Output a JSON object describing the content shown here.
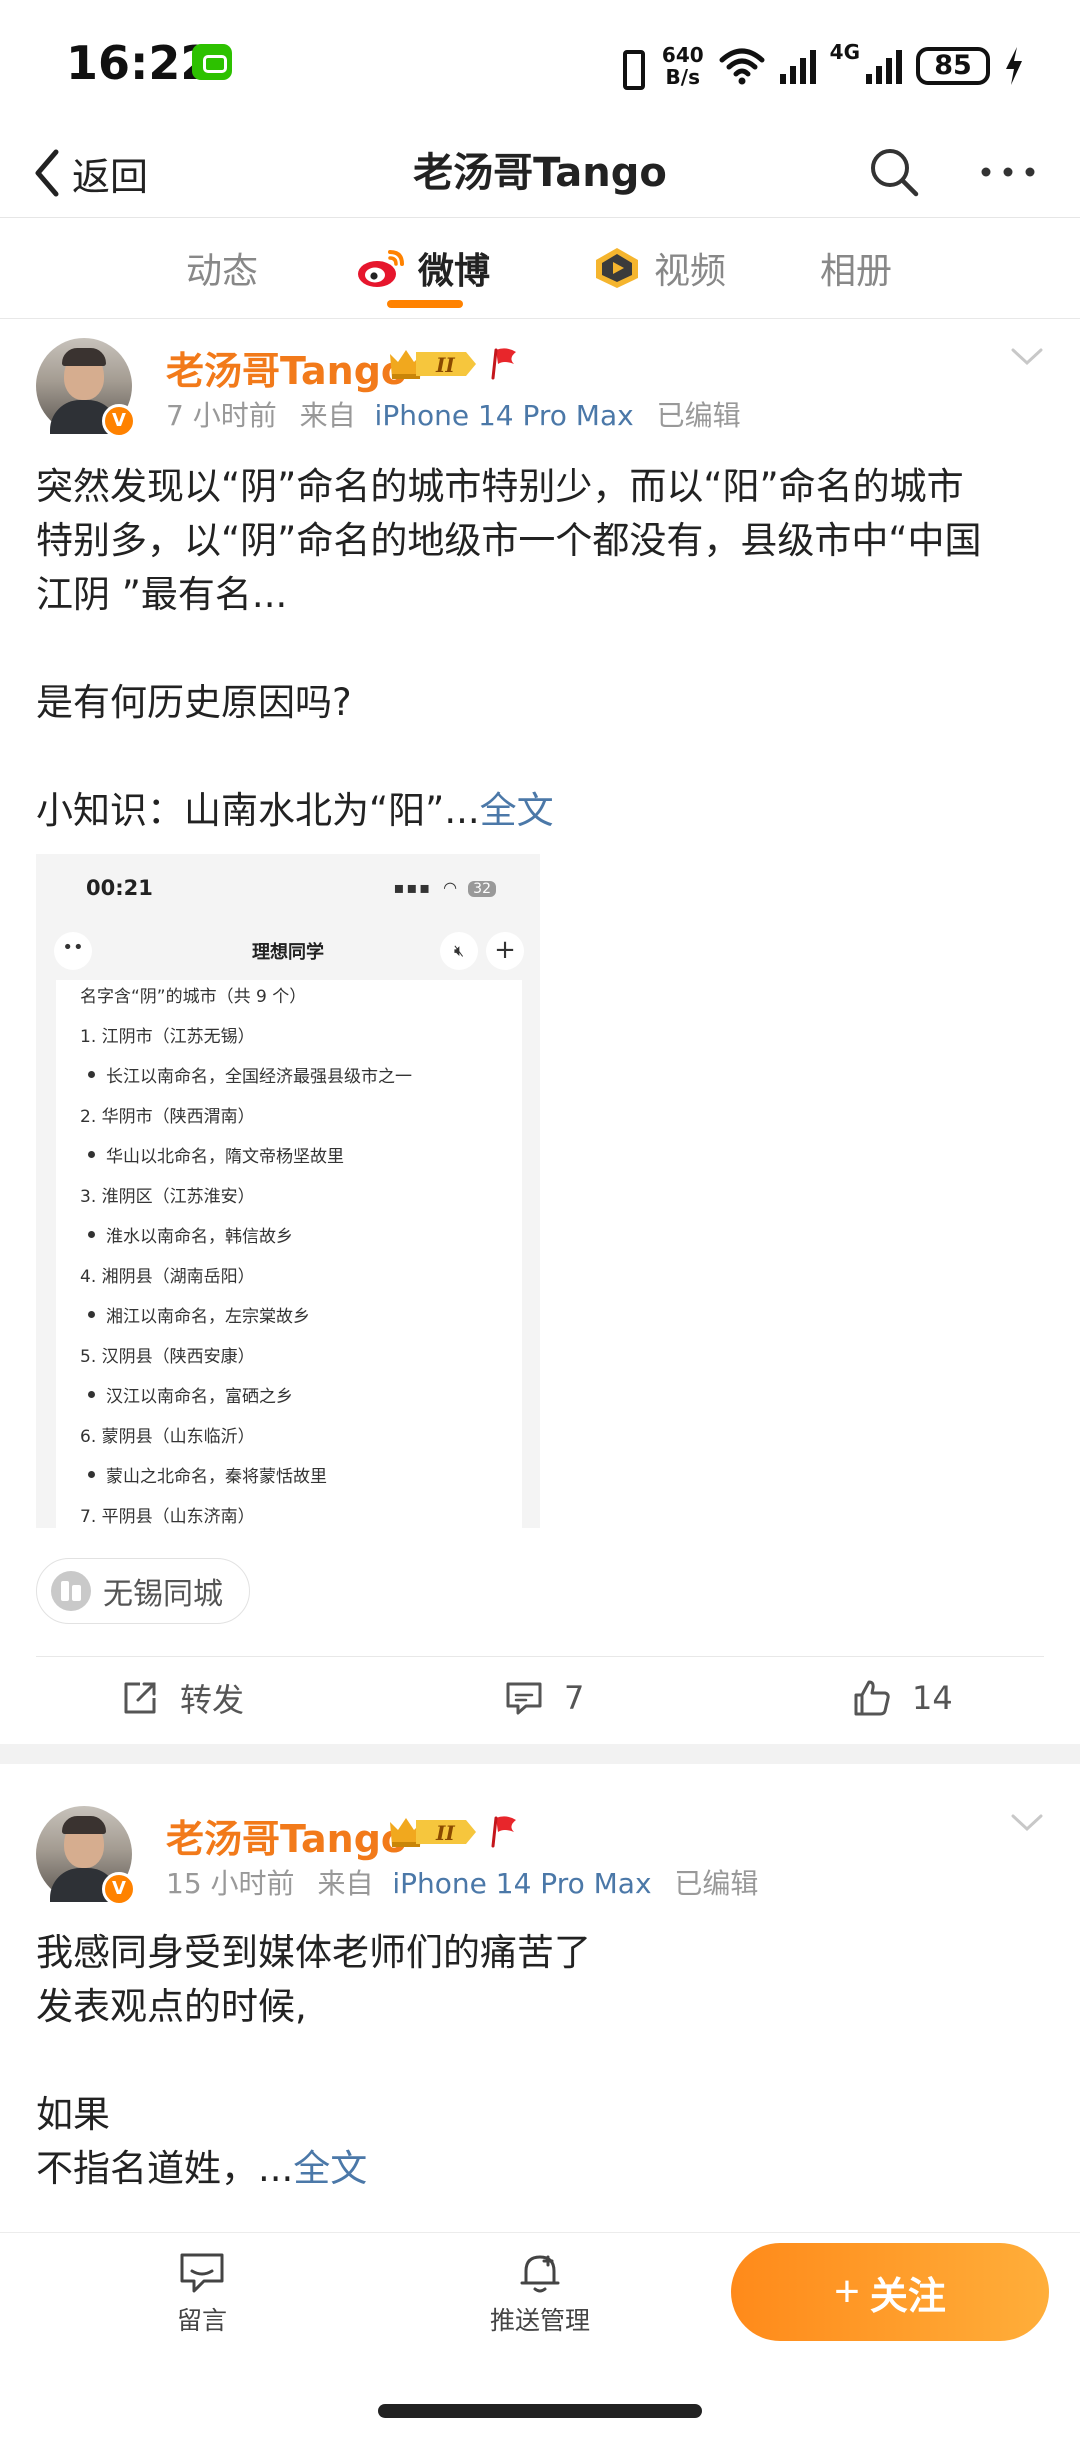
{
  "status": {
    "time": "16:22",
    "net_speed_value": "640",
    "net_speed_unit": "B/s",
    "network_type": "4G",
    "battery": "85"
  },
  "header": {
    "back_label": "返回",
    "title": "老汤哥Tango"
  },
  "tabs": [
    {
      "label": "动态"
    },
    {
      "label": "微博"
    },
    {
      "label": "视频"
    },
    {
      "label": "相册"
    }
  ],
  "active_tab": "微博",
  "colors": {
    "accent": "#ff8200",
    "username": "#f27a1a",
    "link": "#4b78a8"
  },
  "posts": [
    {
      "username": "老汤哥Tango",
      "level_badge": "II",
      "time": "7 小时前",
      "source_prefix": "来自",
      "source": "iPhone 14 Pro Max",
      "edited": "已编辑",
      "lines": [
        "突然发现以“阴”命名的城市特别少，而以“阳”命名的城市",
        "特别多，以“阴”命名的地级市一个都没有，县级市中“中国",
        "江阴 ”最有名...",
        "",
        "是有何历史原因吗?",
        "",
        "小知识：山南水北为“阳”..."
      ],
      "more_label": "全文",
      "image": {
        "time": "00:21",
        "battery": "32",
        "title": "理想同学",
        "lines": [
          "名字含“阴”的城市（共 9 个）",
          "1. 江阴市（江苏无锡）",
          "长江以南命名，全国经济最强县级市之一",
          "2. 华阴市（陕西渭南）",
          "华山以北命名，隋文帝杨坚故里",
          "3. 淮阴区（江苏淮安）",
          "淮水以南命名，韩信故乡",
          "4. 湘阴县（湖南岳阳）",
          "湘江以南命名，左宗棠故乡",
          "5. 汉阴县（陕西安康）",
          "汉江以南命名，富硒之乡",
          "6. 蒙阴县（山东临沂）",
          "蒙山之北命名，秦将蒙恬故里",
          "7. 平阴县（山东济南）"
        ]
      },
      "location": "无锡同城",
      "repost_label": "转发",
      "comments": "7",
      "likes": "14"
    },
    {
      "username": "老汤哥Tango",
      "level_badge": "II",
      "time": "15 小时前",
      "source_prefix": "来自",
      "source": "iPhone 14 Pro Max",
      "edited": "已编辑",
      "lines": [
        "我感同身受到媒体老师们的痛苦了",
        "发表观点的时候,",
        "",
        "如果",
        "不指名道姓，..."
      ],
      "more_label": "全文"
    }
  ],
  "bottom": {
    "message_label": "留言",
    "push_label": "推送管理",
    "follow_label": "关注"
  }
}
